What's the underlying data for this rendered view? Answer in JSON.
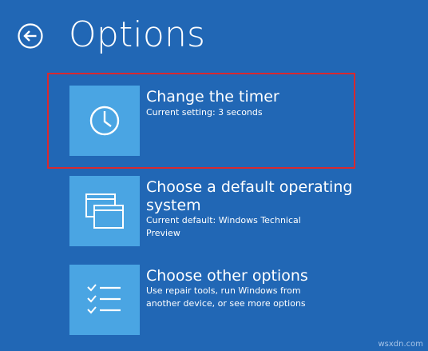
{
  "header": {
    "title": "Options",
    "back_icon": "back-arrow-icon"
  },
  "options": [
    {
      "label": "Change the timer",
      "description": "Current setting: 3 seconds",
      "icon": "clock-icon",
      "selected": true
    },
    {
      "label": "Choose a default operating system",
      "description": "Current default: Windows Technical Preview",
      "icon": "windows-stack-icon"
    },
    {
      "label": "Choose other options",
      "description": "Use repair tools, run Windows from another device, or see more options",
      "icon": "checklist-icon"
    }
  ],
  "colors": {
    "background": "#2167b5",
    "tile": "#4aa5e3",
    "selection_border": "#d8292f"
  },
  "watermark": "wsxdn.com"
}
